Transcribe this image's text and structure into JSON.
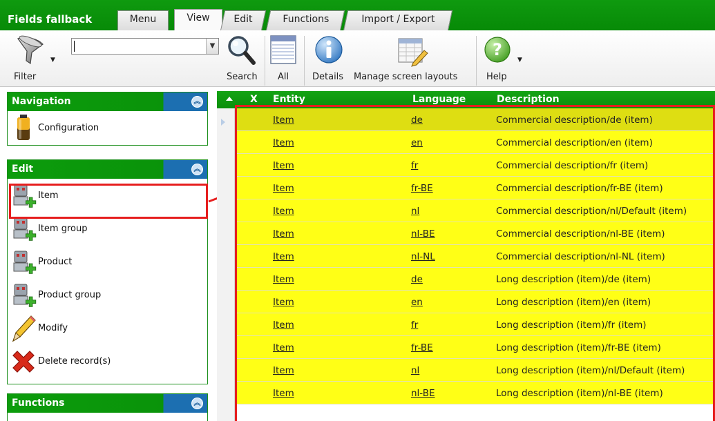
{
  "app": {
    "title": "Fields fallback"
  },
  "tabs": [
    {
      "label": "Menu"
    },
    {
      "label": "View"
    },
    {
      "label": "Edit"
    },
    {
      "label": "Functions"
    },
    {
      "label": "Import / Export"
    }
  ],
  "active_tab": "View",
  "ribbon": {
    "filter_label": "Filter",
    "filter_value": "",
    "search_label": "Search",
    "all_label": "All",
    "details_label": "Details",
    "layouts_label": "Manage screen layouts",
    "help_label": "Help"
  },
  "sidebar": {
    "navigation": {
      "title": "Navigation",
      "items": [
        {
          "label": "Configuration",
          "icon": "battery-icon"
        }
      ]
    },
    "edit": {
      "title": "Edit",
      "items": [
        {
          "label": "Item",
          "icon": "robot-add-icon"
        },
        {
          "label": "Item group",
          "icon": "robot-add-icon"
        },
        {
          "label": "Product",
          "icon": "robot-add-icon"
        },
        {
          "label": "Product group",
          "icon": "robot-add-icon"
        },
        {
          "label": "Modify",
          "icon": "pencil-icon"
        },
        {
          "label": "Delete record(s)",
          "icon": "delete-x-icon"
        }
      ]
    },
    "functions": {
      "title": "Functions"
    }
  },
  "grid": {
    "columns": {
      "x": "X",
      "entity": "Entity",
      "language": "Language",
      "description": "Description"
    },
    "rows": [
      {
        "entity": "Item",
        "language": "de",
        "description": "Commercial description/de (item)"
      },
      {
        "entity": "Item",
        "language": "en",
        "description": "Commercial description/en (item)"
      },
      {
        "entity": "Item",
        "language": "fr",
        "description": "Commercial description/fr (item)"
      },
      {
        "entity": "Item",
        "language": "fr-BE",
        "description": "Commercial description/fr-BE (item)"
      },
      {
        "entity": "Item",
        "language": "nl",
        "description": "Commercial description/nl/Default (item)"
      },
      {
        "entity": "Item",
        "language": "nl-BE",
        "description": "Commercial description/nl-BE (item)"
      },
      {
        "entity": "Item",
        "language": "nl-NL",
        "description": "Commercial description/nl-NL (item)"
      },
      {
        "entity": "Item",
        "language": "de",
        "description": "Long description (item)/de (item)"
      },
      {
        "entity": "Item",
        "language": "en",
        "description": "Long description (item)/en (item)"
      },
      {
        "entity": "Item",
        "language": "fr",
        "description": "Long description (item)/fr (item)"
      },
      {
        "entity": "Item",
        "language": "fr-BE",
        "description": "Long description (item)/fr-BE (item)"
      },
      {
        "entity": "Item",
        "language": "nl",
        "description": "Long description (item)/nl/Default (item)"
      },
      {
        "entity": "Item",
        "language": "nl-BE",
        "description": "Long description (item)/nl-BE (item)"
      }
    ]
  },
  "colors": {
    "green": "#0c9c0c",
    "row_yellow": "#ffff16",
    "selected_row": "#dede12",
    "highlight_red": "#e61e1e",
    "collapse_blue": "#1c6fb1"
  }
}
